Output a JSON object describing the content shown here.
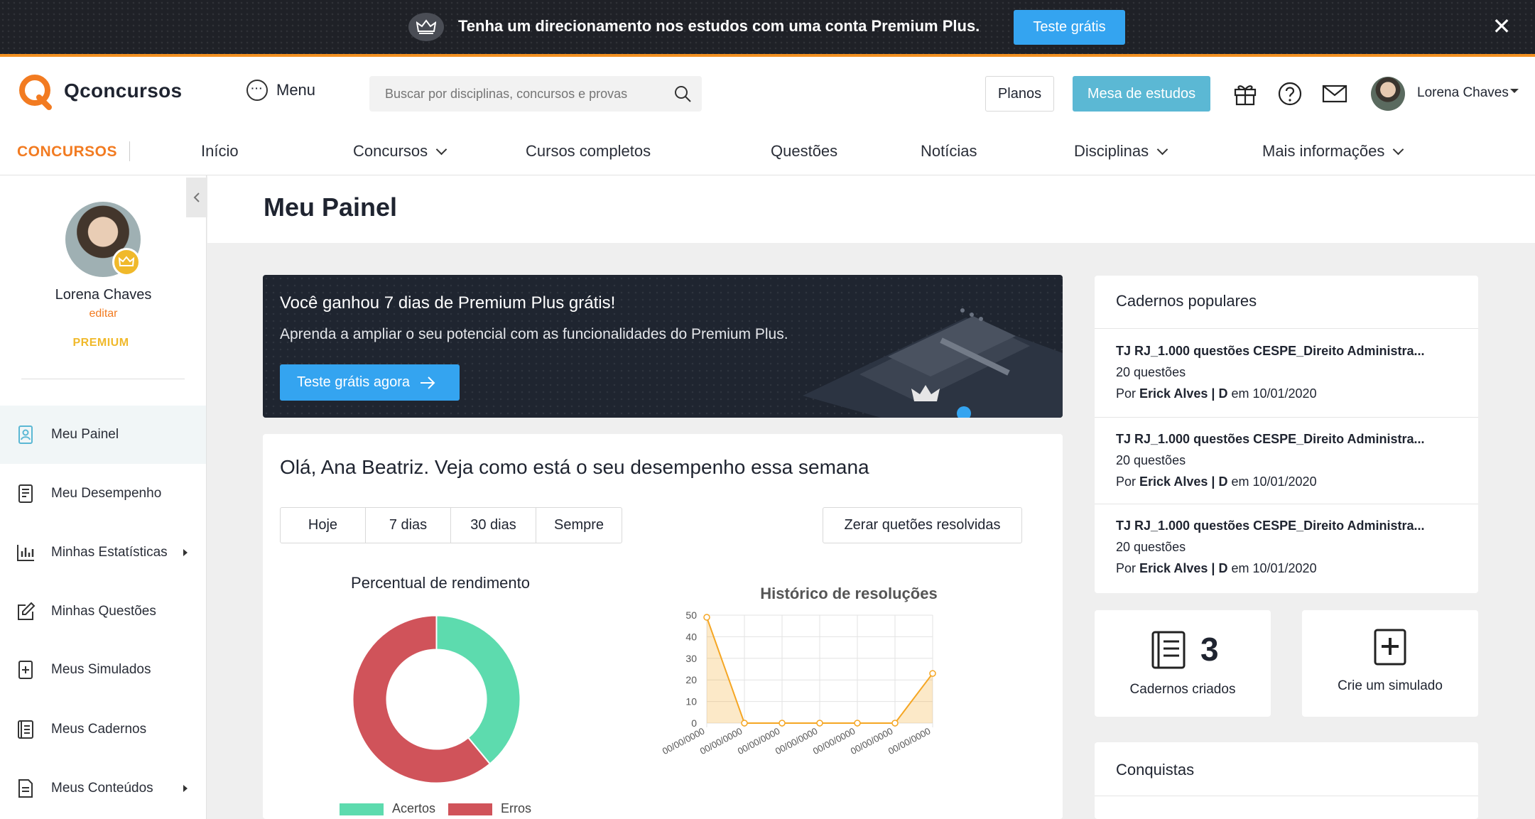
{
  "promo": {
    "text": "Tenha um direcionamento nos estudos com uma conta Premium Plus.",
    "button": "Teste grátis",
    "close_symbol": "✕"
  },
  "header": {
    "logo_text": "Qconcursos",
    "menu_label": "Menu",
    "search_placeholder": "Buscar por disciplinas, concursos e provas",
    "planos": "Planos",
    "mesa": "Mesa de estudos",
    "user_name": "Lorena Chaves",
    "icons": [
      "gift-icon",
      "help-icon",
      "mail-icon"
    ]
  },
  "nav": {
    "section": "CONCURSOS",
    "items": [
      {
        "label": "Início",
        "dropdown": false
      },
      {
        "label": "Concursos",
        "dropdown": true
      },
      {
        "label": "Cursos completos",
        "dropdown": false
      },
      {
        "label": "Questões",
        "dropdown": false
      },
      {
        "label": "Notícias",
        "dropdown": false
      },
      {
        "label": "Disciplinas",
        "dropdown": true
      },
      {
        "label": "Mais informações",
        "dropdown": true
      }
    ]
  },
  "profile": {
    "name": "Lorena Chaves",
    "edit": "editar",
    "tier": "PREMIUM"
  },
  "sidebar": {
    "items": [
      {
        "label": "Meu Painel",
        "icon": "dashboard-icon",
        "active": true,
        "submenu": false
      },
      {
        "label": "Meu Desempenho",
        "icon": "performance-icon",
        "active": false,
        "submenu": false
      },
      {
        "label": "Minhas Estatísticas",
        "icon": "statistics-icon",
        "active": false,
        "submenu": true
      },
      {
        "label": "Minhas Questões",
        "icon": "edit-icon",
        "active": false,
        "submenu": false
      },
      {
        "label": "Meus Simulados",
        "icon": "simulado-icon",
        "active": false,
        "submenu": false
      },
      {
        "label": "Meus Cadernos",
        "icon": "notebook-icon",
        "active": false,
        "submenu": false
      },
      {
        "label": "Meus Conteúdos",
        "icon": "content-icon",
        "active": false,
        "submenu": true
      }
    ]
  },
  "main": {
    "title": "Meu Painel",
    "premium": {
      "title": "Você ganhou 7 dias de Premium Plus grátis!",
      "subtitle": "Aprenda a ampliar o seu potencial com as funcionalidades do Premium Plus.",
      "button": "Teste grátis agora"
    },
    "performance": {
      "title": "Olá, Ana Beatriz. Veja como está o seu desempenho essa semana",
      "filters": [
        "Hoje",
        "7 dias",
        "30 dias",
        "Sempre"
      ],
      "reset": "Zerar quetões resolvidas"
    }
  },
  "chart_data": [
    {
      "type": "pie",
      "title": "Percentual de rendimento",
      "categories": [
        "Acertos",
        "Erros"
      ],
      "values": [
        39,
        61
      ],
      "colors": [
        "#5ddbae",
        "#d0535a"
      ],
      "legend": "bottom"
    },
    {
      "type": "area",
      "title": "Histórico de resoluções",
      "x": [
        "00/00/0000",
        "00/00/0000",
        "00/00/0000",
        "00/00/0000",
        "00/00/0000",
        "00/00/0000",
        "00/00/0000"
      ],
      "values": [
        49,
        0,
        0,
        0,
        0,
        0,
        23
      ],
      "ylim": [
        0,
        50
      ],
      "yticks": [
        0,
        10,
        20,
        30,
        40,
        50
      ],
      "color": "#f5a623",
      "grid": true
    }
  ],
  "popular": {
    "title": "Cadernos populares",
    "items": [
      {
        "title": "TJ RJ_1.000 questões CESPE_Direito Administra...",
        "count": "20 questões",
        "by": "Por",
        "author": "Erick Alves | D",
        "date": "em 10/01/2020"
      },
      {
        "title": "TJ RJ_1.000 questões CESPE_Direito Administra...",
        "count": "20 questões",
        "by": "Por",
        "author": "Erick Alves | D",
        "date": "em 10/01/2020"
      },
      {
        "title": "TJ RJ_1.000 questões CESPE_Direito Administra...",
        "count": "20 questões",
        "by": "Por",
        "author": "Erick Alves | D",
        "date": "em 10/01/2020"
      }
    ]
  },
  "cadernos": {
    "count": "3",
    "label": "Cadernos criados"
  },
  "simulado": {
    "label": "Crie um simulado"
  },
  "conquistas": {
    "title": "Conquistas"
  },
  "colors": {
    "accent": "#f27b21",
    "primary_blue": "#34a4f0",
    "teal": "#5bb8d4",
    "premium_gold": "#f0b92b"
  }
}
